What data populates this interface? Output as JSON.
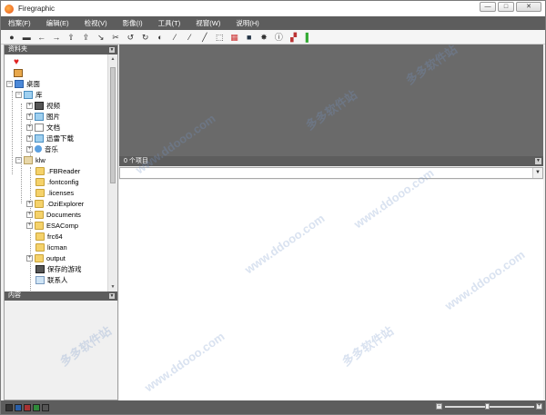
{
  "window": {
    "title": "Firegraphic",
    "controls": [
      "—",
      "□",
      "✕"
    ]
  },
  "menu": [
    {
      "label": "档案(F)"
    },
    {
      "label": "编辑(E)"
    },
    {
      "label": "检视(V)"
    },
    {
      "label": "影像(I)"
    },
    {
      "label": "工具(T)"
    },
    {
      "label": "视窗(W)"
    },
    {
      "label": "说明(H)"
    }
  ],
  "toolbar_icons": [
    "camera-icon",
    "printer-icon",
    "back-icon",
    "forward-icon",
    "folder-up-icon",
    "folder-open-icon",
    "move-icon",
    "cut-icon",
    "rotate-left-icon",
    "rotate-right-icon",
    "contrast-icon",
    "wand-icon",
    "magic-brush-icon",
    "line-icon",
    "select-rect-icon",
    "histogram-icon",
    "screen-icon",
    "settings-icon",
    "info-icon",
    "color-picker-icon",
    "palette-icon"
  ],
  "left_panel": {
    "header": "资料夹",
    "tree": [
      {
        "label": "",
        "icon": "heart"
      },
      {
        "label": "",
        "icon": "case"
      },
      {
        "label": "桌面",
        "icon": "desktop"
      },
      {
        "label": "库",
        "icon": "lib"
      },
      {
        "label": "视频",
        "icon": "film"
      },
      {
        "label": "图片",
        "icon": "image"
      },
      {
        "label": "文档",
        "icon": "file"
      },
      {
        "label": "迅雷下载",
        "icon": "download"
      },
      {
        "label": "音乐",
        "icon": "music"
      },
      {
        "label": "klw",
        "icon": "user"
      },
      {
        "label": ".FBReader",
        "icon": "folder"
      },
      {
        "label": ".fontconfig",
        "icon": "folder"
      },
      {
        "label": ".licenses",
        "icon": "folder"
      },
      {
        "label": ".OziExplorer",
        "icon": "folder"
      },
      {
        "label": "Documents",
        "icon": "folder"
      },
      {
        "label": "ESAComp",
        "icon": "folder"
      },
      {
        "label": "frc64",
        "icon": "folder"
      },
      {
        "label": "licman",
        "icon": "folder"
      },
      {
        "label": "output",
        "icon": "folder"
      },
      {
        "label": "保存的游戏",
        "icon": "game"
      },
      {
        "label": "联系人",
        "icon": "contact"
      }
    ],
    "content_header": "内容"
  },
  "list": {
    "header": "0 个项目"
  },
  "watermarks": [
    "多多软件站",
    "www.ddooo.com",
    "多多软件站",
    "www.ddooo.com",
    "多多软件站",
    "www.ddooo.com",
    "www.ddooo.com",
    "多多软件站",
    "www.ddooo.com"
  ]
}
